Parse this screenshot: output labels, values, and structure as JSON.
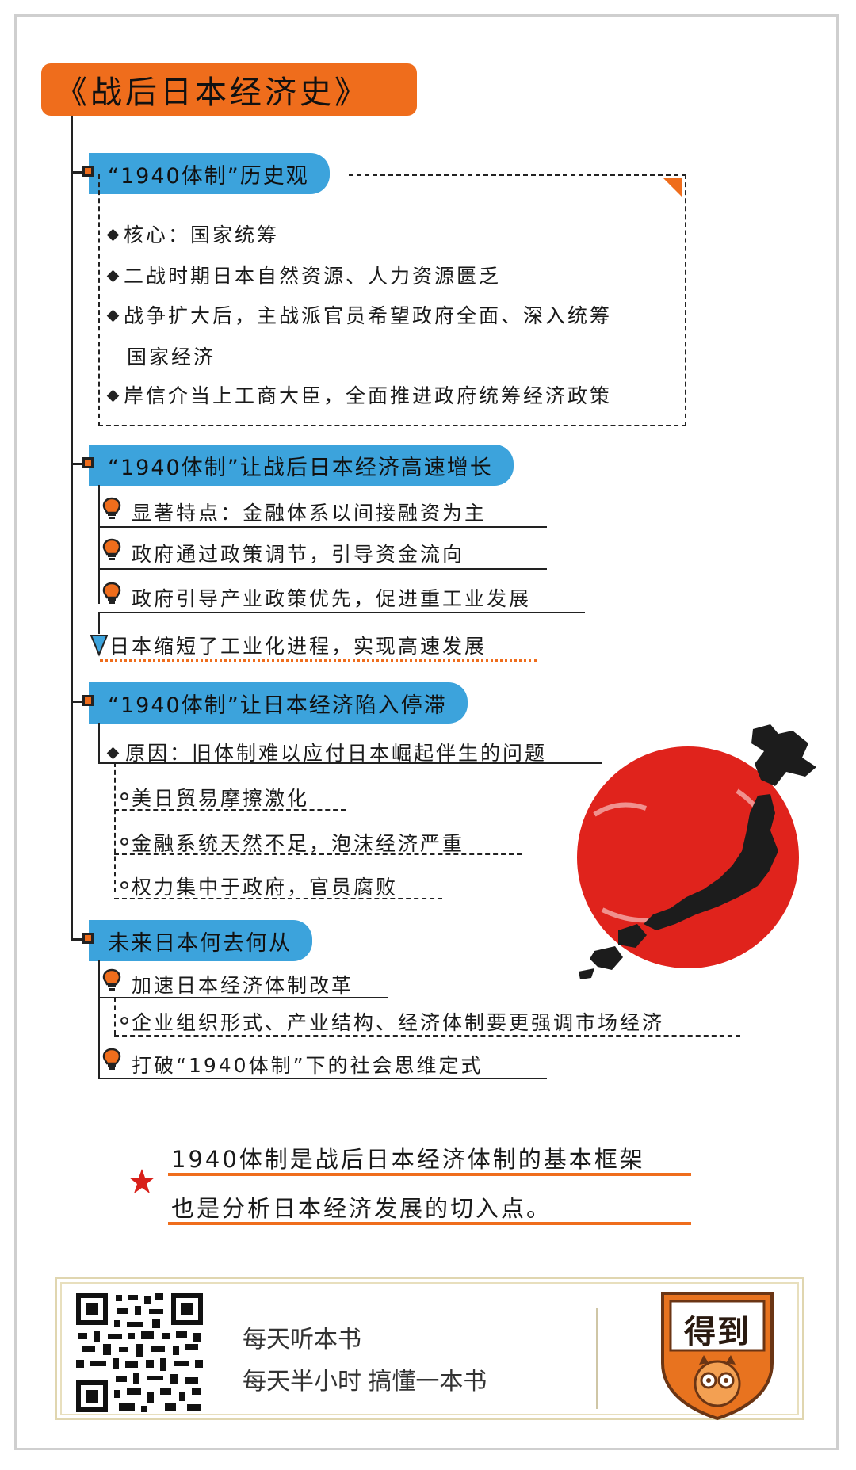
{
  "title": "《战后日本经济史》",
  "sections": [
    {
      "heading": "“1940体制”历史观",
      "items": [
        "核心：国家统筹",
        "二战时期日本自然资源、人力资源匮乏",
        "战争扩大后，主战派官员希望政府全面、深入统筹",
        "国家经济",
        "岸信介当上工商大臣，全面推进政府统筹经济政策"
      ]
    },
    {
      "heading": "“1940体制”让战后日本经济高速增长",
      "items": [
        "显著特点：金融体系以间接融资为主",
        "政府通过政策调节，引导资金流向",
        "政府引导产业政策优先，促进重工业发展"
      ],
      "result": "日本缩短了工业化进程，实现高速发展"
    },
    {
      "heading": "“1940体制”让日本经济陷入停滞",
      "reason": "原因：旧体制难以应付日本崛起伴生的问题",
      "sub_items": [
        "美日贸易摩擦激化",
        "金融系统天然不足，泡沫经济严重",
        "权力集中于政府，官员腐败"
      ]
    },
    {
      "heading": "未来日本何去何从",
      "items": [
        "加速日本经济体制改革",
        "打破“1940体制”下的社会思维定式"
      ],
      "sub_item": "企业组织形式、产业结构、经济体制要更强调市场经济"
    }
  ],
  "note": {
    "line1": "1940体制是战后日本经济体制的基本框架",
    "line2": "也是分析日本经济发展的切入点。"
  },
  "footer": {
    "line1": "每天听本书",
    "line2": "每天半小时 搞懂一本书",
    "logo_text": "得到"
  },
  "colors": {
    "accent_orange": "#ef6d1c",
    "heading_blue": "#3ca3dc",
    "sun_red": "#e0231c"
  },
  "icons": [
    "diamond-bullet-icon",
    "lightbulb-icon",
    "circle-bullet-icon",
    "star-icon",
    "qr-code",
    "japan-map",
    "dedao-owl-logo"
  ]
}
